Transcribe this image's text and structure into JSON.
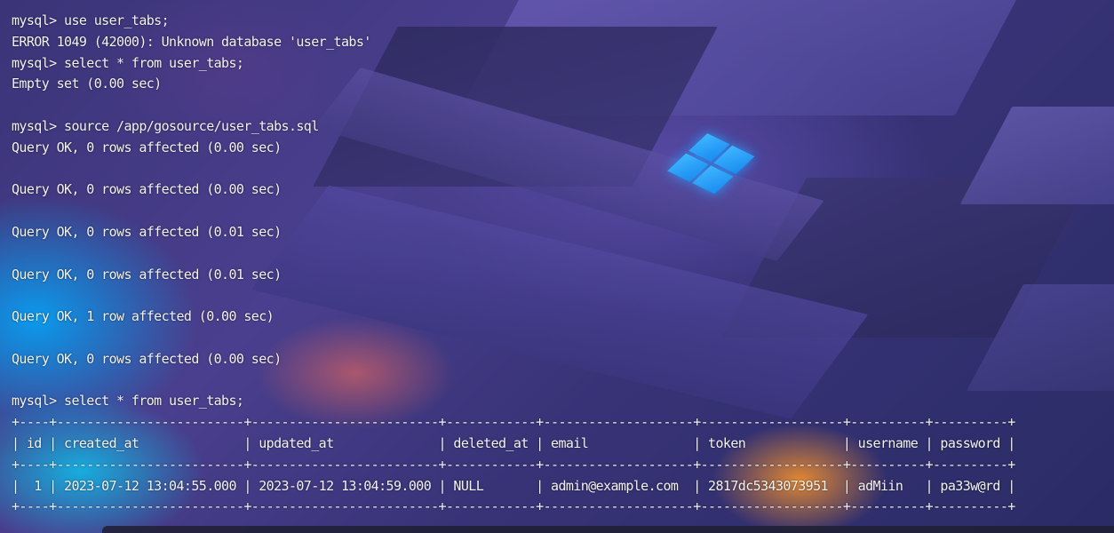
{
  "terminal": {
    "lines": [
      "mysql> use user_tabs;",
      "ERROR 1049 (42000): Unknown database 'user_tabs'",
      "mysql> select * from user_tabs;",
      "Empty set (0.00 sec)",
      "",
      "mysql> source /app/gosource/user_tabs.sql",
      "Query OK, 0 rows affected (0.00 sec)",
      "",
      "Query OK, 0 rows affected (0.00 sec)",
      "",
      "Query OK, 0 rows affected (0.01 sec)",
      "",
      "Query OK, 0 rows affected (0.01 sec)",
      "",
      "Query OK, 1 row affected (0.00 sec)",
      "",
      "Query OK, 0 rows affected (0.00 sec)",
      "",
      "mysql> select * from user_tabs;",
      "+----+-------------------------+-------------------------+------------+--------------------+-------------------+----------+----------+",
      "| id | created_at              | updated_at              | deleted_at | email              | token             | username | password |",
      "+----+-------------------------+-------------------------+------------+--------------------+-------------------+----------+----------+",
      "|  1 | 2023-07-12 13:04:55.000 | 2023-07-12 13:04:59.000 | NULL       | admin@example.com  | 2817dc5343073951  | adMiin   | pa33w@rd |",
      "+----+-------------------------+-------------------------+------------+--------------------+-------------------+----------+----------+"
    ]
  },
  "colors": {
    "text": "#f2f2f2",
    "windows_logo": "#2aa0ff"
  },
  "icons": [
    "windows-logo-icon"
  ]
}
